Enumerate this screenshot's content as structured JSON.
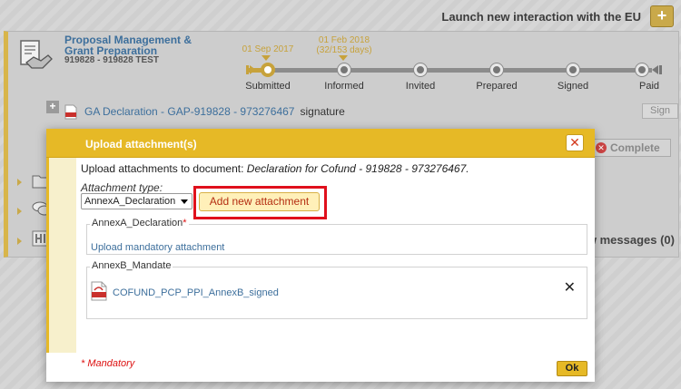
{
  "topbar": {
    "launch_label": "Launch new interaction with the EU",
    "plus_symbol": "+"
  },
  "project": {
    "title": "Proposal Management & Grant Preparation",
    "id_line": "919828 - 919828 TEST",
    "icon": "handshake-document-icon"
  },
  "timeline": {
    "dates": [
      "01 Sep 2017",
      "01 Feb 2018\n(32/153 days)"
    ],
    "date_1": "01 Sep 2017",
    "date_2a": "01 Feb 2018",
    "date_2b": "(32/153 days)",
    "steps": [
      "Submitted",
      "Informed",
      "Invited",
      "Prepared",
      "Signed",
      "Paid"
    ],
    "active_step": "Submitted",
    "accent_color": "#c7a23b"
  },
  "document_row": {
    "expand_symbol": "+",
    "link": "GA Declaration - GAP-919828 - 973276467",
    "suffix": "signature",
    "sign_label": "Sign",
    "complete_label": "Complete",
    "complete_icon": "x-circle-icon"
  },
  "background": {
    "new_messages": "w messages (0)"
  },
  "modal": {
    "title": "Upload attachment(s)",
    "close_symbol": "✕",
    "intro_prefix": "Upload attachments to document: ",
    "intro_doc": "Declaration for Cofund - 919828 - 973276467.",
    "attachment_type_label": "Attachment type:",
    "attachment_type_value": "AnnexA_Declaration",
    "add_button_label": "Add new attachment",
    "sections": [
      {
        "legend": "AnnexA_Declaration",
        "required_marker": "*",
        "link": "Upload mandatory attachment"
      },
      {
        "legend": "AnnexB_Mandate",
        "file": "COFUND_PCP_PPI_AnnexB_signed",
        "remove_symbol": "✕"
      }
    ],
    "mandatory_note": "* Mandatory",
    "ok_label": "Ok",
    "header_color": "#e6b926",
    "highlight_color": "#e0101c"
  }
}
